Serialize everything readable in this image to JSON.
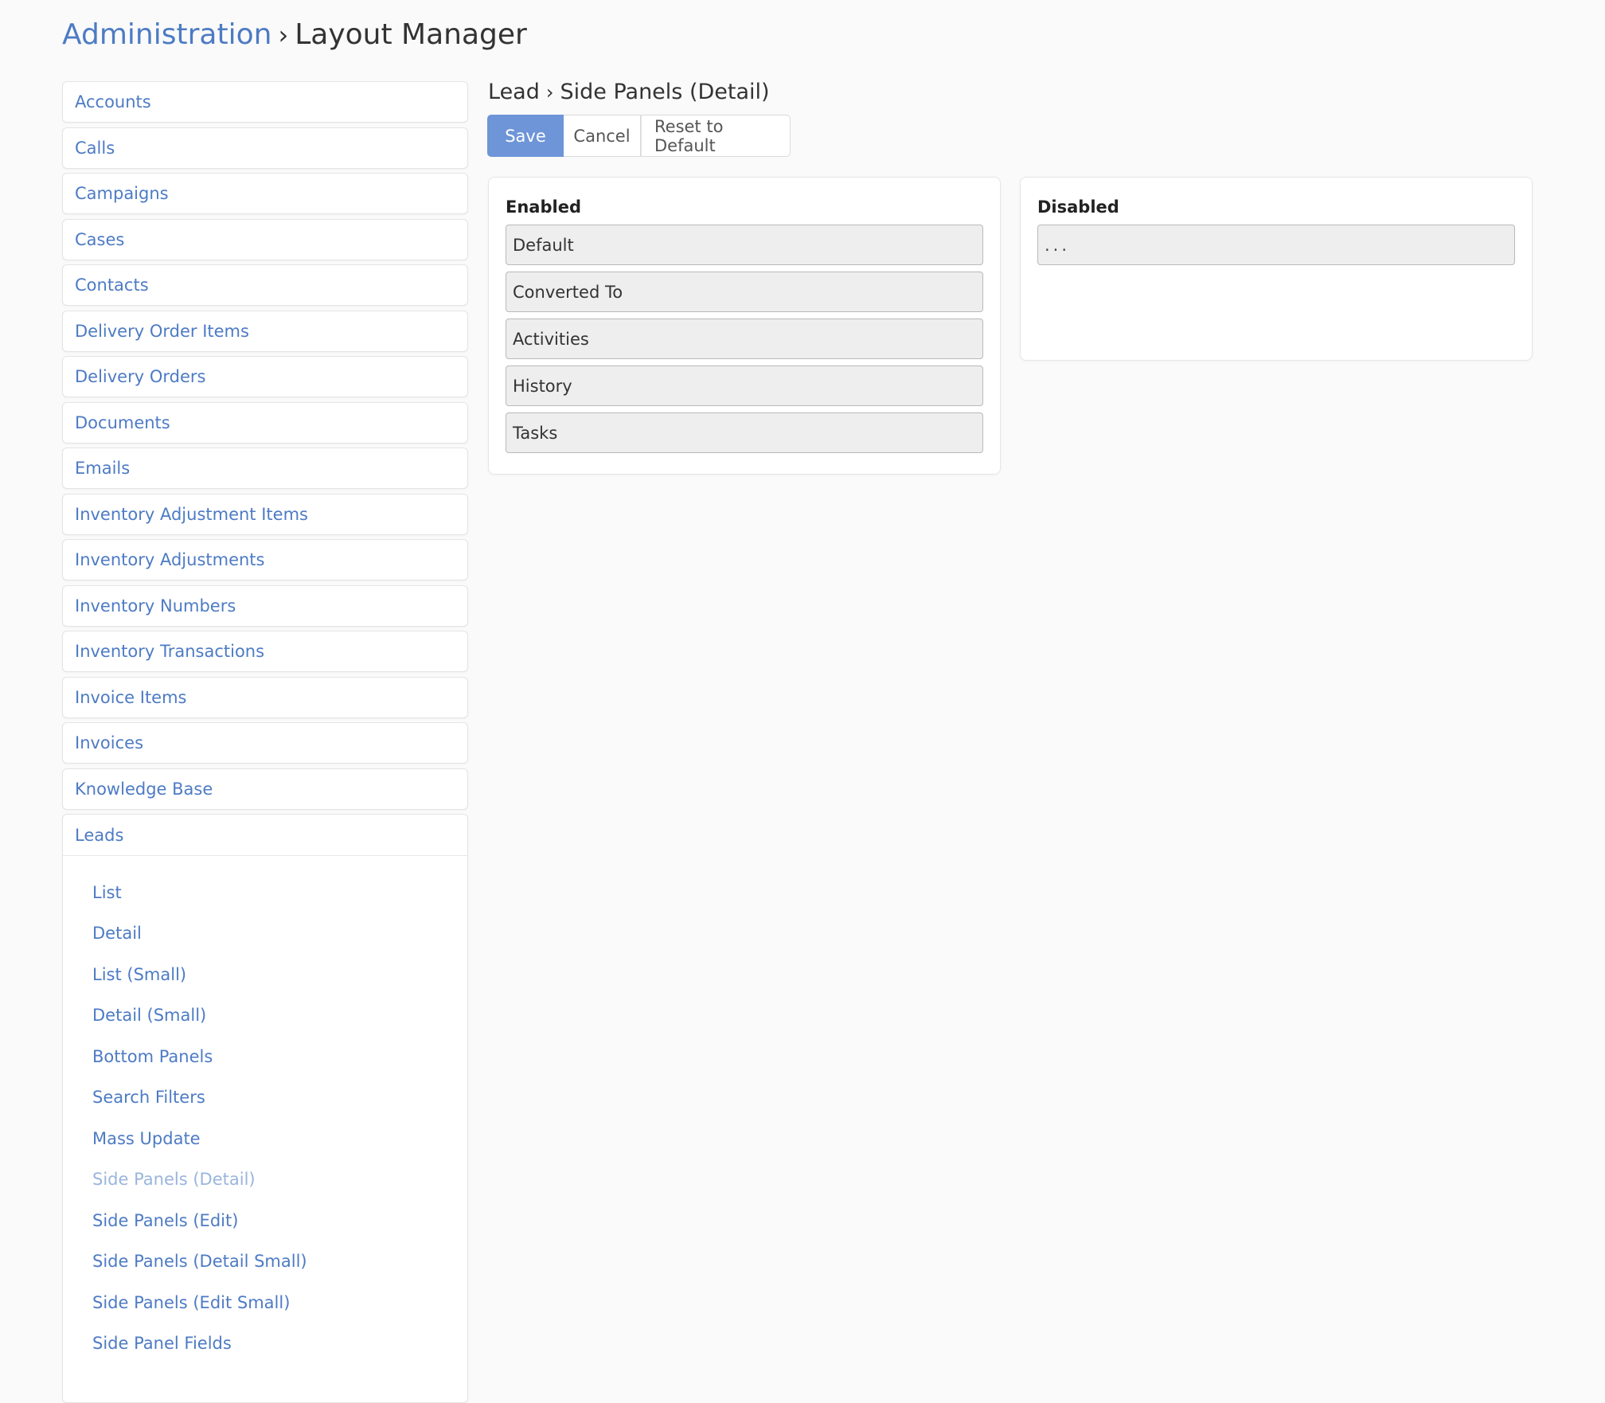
{
  "header": {
    "root_link": "Administration",
    "separator": "›",
    "current": "Layout Manager"
  },
  "sidebar": {
    "items": [
      {
        "label": "Accounts"
      },
      {
        "label": "Calls"
      },
      {
        "label": "Campaigns"
      },
      {
        "label": "Cases"
      },
      {
        "label": "Contacts"
      },
      {
        "label": "Delivery Order Items"
      },
      {
        "label": "Delivery Orders"
      },
      {
        "label": "Documents"
      },
      {
        "label": "Emails"
      },
      {
        "label": "Inventory Adjustment Items"
      },
      {
        "label": "Inventory Adjustments"
      },
      {
        "label": "Inventory Numbers"
      },
      {
        "label": "Inventory Transactions"
      },
      {
        "label": "Invoice Items"
      },
      {
        "label": "Invoices"
      },
      {
        "label": "Knowledge Base"
      }
    ],
    "expanded_group": {
      "label": "Leads",
      "subitems": [
        {
          "label": "List"
        },
        {
          "label": "Detail"
        },
        {
          "label": "List (Small)"
        },
        {
          "label": "Detail (Small)"
        },
        {
          "label": "Bottom Panels"
        },
        {
          "label": "Search Filters"
        },
        {
          "label": "Mass Update"
        },
        {
          "label": "Side Panels (Detail)",
          "active": true
        },
        {
          "label": "Side Panels (Edit)"
        },
        {
          "label": "Side Panels (Detail Small)"
        },
        {
          "label": "Side Panels (Edit Small)"
        },
        {
          "label": "Side Panel Fields"
        }
      ]
    }
  },
  "main": {
    "entity": "Lead",
    "separator": "›",
    "layout_name": "Side Panels (Detail)",
    "buttons": {
      "save": "Save",
      "cancel": "Cancel",
      "reset": "Reset to Default"
    },
    "enabled": {
      "title": "Enabled",
      "items": [
        "Default",
        "Converted To",
        "Activities",
        "History",
        "Tasks"
      ]
    },
    "disabled": {
      "title": "Disabled",
      "items": [
        "..."
      ]
    }
  },
  "colors": {
    "link": "#4d7bc4",
    "active_link": "#9ab5dc",
    "primary_button": "#6d95d8",
    "background": "#fafafa"
  }
}
